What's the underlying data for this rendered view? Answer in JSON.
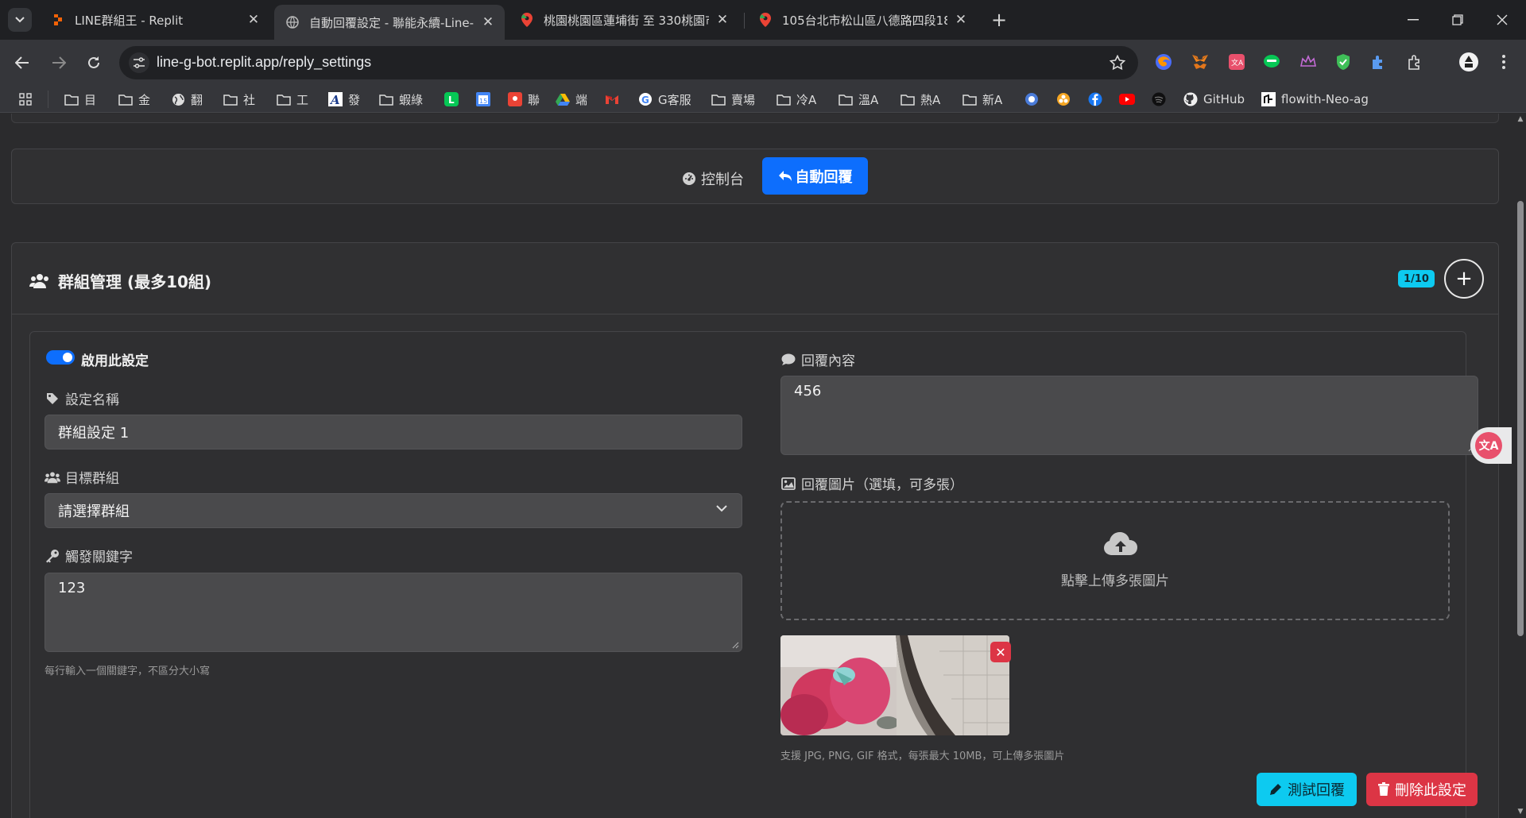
{
  "tabs": [
    {
      "title": "LINE群組王 - Replit",
      "close": "✕"
    },
    {
      "title": "自動回覆設定 - 聯能永續-Line-",
      "close": "✕"
    },
    {
      "title": "桃園桃園區蓮埔街 至 330桃園市",
      "close": "✕"
    },
    {
      "title": "105台北市松山區八德路四段18",
      "close": "✕"
    }
  ],
  "new_tab": "+",
  "address": {
    "url": "line-g-bot.replit.app/reply_settings"
  },
  "bookmarks": [
    {
      "label": "目",
      "icon": "folder-icon"
    },
    {
      "label": "金",
      "icon": "folder-icon"
    },
    {
      "label": "翻",
      "icon": "globe-icon"
    },
    {
      "label": "社",
      "icon": "folder-icon"
    },
    {
      "label": "工",
      "icon": "folder-icon"
    },
    {
      "label": "發",
      "icon": "a-icon"
    },
    {
      "label": "蝦綠",
      "icon": "folder-icon"
    },
    {
      "label": "聯",
      "icon": "maps-icon"
    },
    {
      "label": "端",
      "icon": "drive-icon"
    },
    {
      "label": "G客服",
      "icon": "google-icon"
    },
    {
      "label": "賣場",
      "icon": "folder-icon"
    },
    {
      "label": "冷A",
      "icon": "folder-icon"
    },
    {
      "label": "溫A",
      "icon": "folder-icon"
    },
    {
      "label": "熱A",
      "icon": "folder-icon"
    },
    {
      "label": "新A",
      "icon": "folder-icon"
    },
    {
      "label": "GitHub",
      "icon": "github-icon"
    },
    {
      "label": "flowith-Neo-ag",
      "icon": "flowith-icon"
    }
  ],
  "page_nav": {
    "dashboard": "控制台",
    "auto_reply": "自動回覆"
  },
  "group_card": {
    "title": "群組管理 (最多10組)",
    "badge": "1/10",
    "add": "+"
  },
  "setting": {
    "enable_label": "啟用此設定",
    "name_label": "設定名稱",
    "name_value": "群組設定 1",
    "target_label": "目標群組",
    "target_value": "請選擇群組",
    "keyword_label": "觸發關鍵字",
    "keyword_value": "123",
    "keyword_hint": "每行輸入一個關鍵字，不區分大小寫",
    "reply_label": "回覆內容",
    "reply_value": "456",
    "image_label": "回覆圖片（選填，可多張）",
    "upload_text": "點擊上傳多張圖片",
    "image_hint": "支援 JPG, PNG, GIF 格式，每張最大 10MB，可上傳多張圖片",
    "remove": "✕",
    "test_button": "測試回覆",
    "delete_button": "刪除此設定"
  },
  "floating_widget": "文A",
  "colors": {
    "primary": "#0d6efd",
    "info": "#0dcaf0",
    "danger": "#dc3545",
    "card": "#303032"
  }
}
